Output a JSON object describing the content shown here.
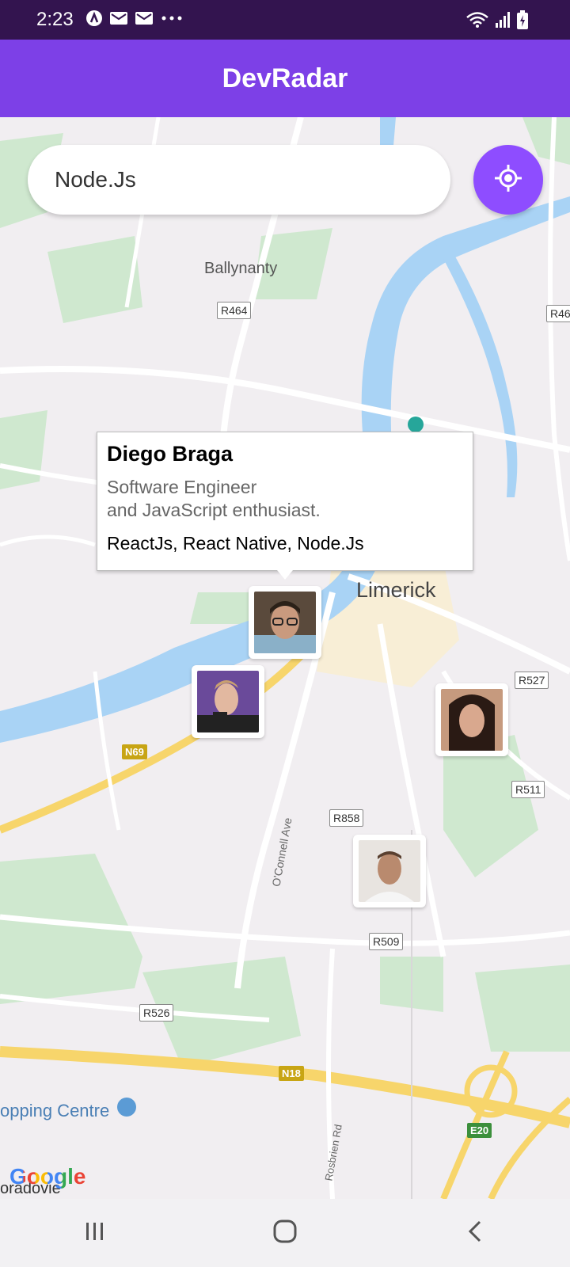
{
  "status_bar": {
    "time": "2:23",
    "icons_left": [
      "app-icon",
      "mail-icon",
      "mail-icon",
      "more-icon"
    ],
    "icons_right": [
      "wifi-icon",
      "signal-icon",
      "battery-charging-icon"
    ]
  },
  "app_bar": {
    "title": "DevRadar",
    "color": "#7D40E7"
  },
  "search": {
    "value": "Node.Js"
  },
  "locate_button": {
    "icon": "my-location-icon",
    "color": "#8E4DFF"
  },
  "map": {
    "place_labels": {
      "ballynanty": "Ballynanty",
      "limerick": "Limerick",
      "shopping_centre": "opping Centre",
      "roradovie": "oradovie",
      "oconnell_ave": "O'Connell Ave",
      "rosbrien_rd": "Rosbrien Rd"
    },
    "road_labels": {
      "r464": "R464",
      "r46": "R46",
      "r527": "R527",
      "r511": "R511",
      "r858": "R858",
      "r509": "R509",
      "r526": "R526"
    },
    "highway_labels": {
      "n69": "N69",
      "n18": "N18",
      "e20": "E20"
    },
    "attribution": "Google"
  },
  "callout": {
    "name": "Diego Braga",
    "bio": "Software Engineer\nand JavaScript enthusiast.",
    "techs": "ReactJs, React Native, Node.Js"
  },
  "markers": [
    {
      "name": "dev-marker-diego-braga"
    },
    {
      "name": "dev-marker-2"
    },
    {
      "name": "dev-marker-3"
    },
    {
      "name": "dev-marker-4"
    }
  ],
  "nav_bar": {
    "recents": "recents-icon",
    "home": "home-icon",
    "back": "back-icon"
  }
}
